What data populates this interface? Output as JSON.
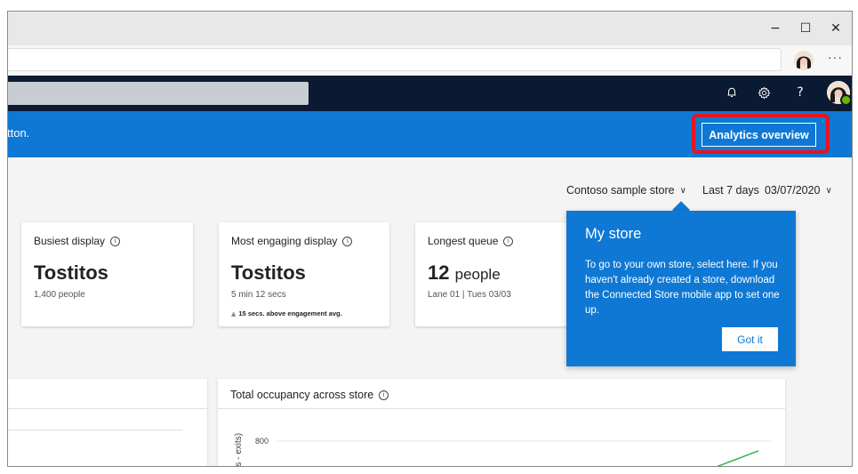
{
  "window": {
    "minimize_glyph": "−",
    "maximize_glyph": "☐",
    "close_glyph": "✕",
    "more_glyph": "···"
  },
  "header": {
    "bell_icon": "bell-icon",
    "gear_icon": "gear-icon",
    "help_glyph": "?"
  },
  "banner": {
    "text": "tton.",
    "analytics_button": "Analytics overview"
  },
  "filters": {
    "store": "Contoso sample store",
    "range_label": "Last 7 days",
    "date": "03/07/2020"
  },
  "cards": [
    {
      "title": "Busiest display",
      "value": "Tostitos",
      "sub": "1,400 people"
    },
    {
      "title": "Most engaging display",
      "value": "Tostitos",
      "sub": "5 min 12 secs",
      "note": "15 secs. above engagement avg."
    },
    {
      "title": "Longest queue",
      "value_number": "12",
      "value_unit": "people",
      "sub": "Lane 01 | Tues 03/03"
    }
  ],
  "callout": {
    "title": "My store",
    "body": "To go to your own store, select here. If you haven't already created a store, download the Connected Store mobile app to set one up.",
    "button": "Got it"
  },
  "occupancy_panel": {
    "title": "Total occupancy across store",
    "y_axis_label": "rs - exits)",
    "y_tick": "800"
  },
  "colors": {
    "brand_blue": "#0f78d4",
    "header_navy": "#0b1a33",
    "highlight_red": "#e8141c",
    "line_green": "#2db84d"
  }
}
